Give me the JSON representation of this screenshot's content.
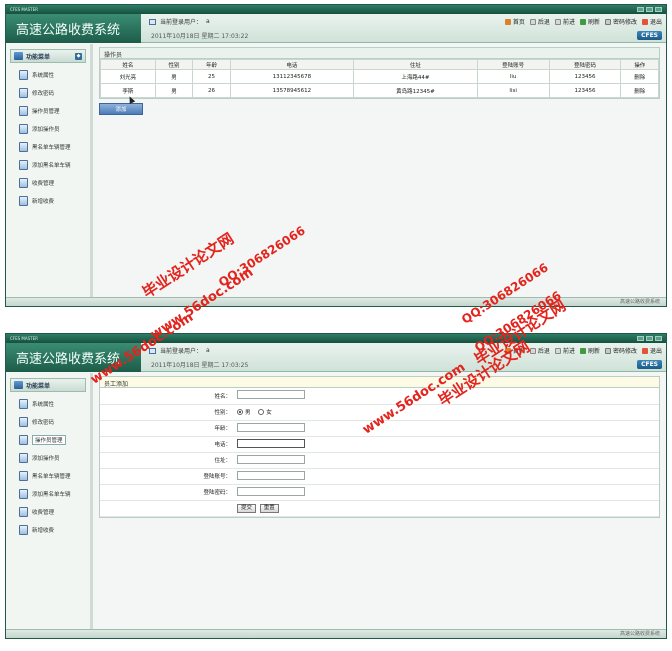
{
  "window": {
    "titlebar_text": "CFES MASTER",
    "logo_text": "高速公路收费系统",
    "current_user_label": "当前登录用户：",
    "current_user": "a",
    "badge": "CFES",
    "statusbar": "高速公路收费系统"
  },
  "toolbar": {
    "home": "首页",
    "back": "后退",
    "forward": "前进",
    "refresh": "刷新",
    "password": "密码修改",
    "logout": "退出"
  },
  "sidebar": {
    "title": "功能菜单",
    "items": [
      {
        "label": "系统属性"
      },
      {
        "label": "修改密码"
      },
      {
        "label": "操作员管理"
      },
      {
        "label": "添加操作员"
      },
      {
        "label": "黑名单车辆管理"
      },
      {
        "label": "添加黑名单车辆"
      },
      {
        "label": "收费管理"
      },
      {
        "label": "新增收费"
      }
    ]
  },
  "screen1": {
    "date": "2011年10月18日  星期二  17:03:22",
    "panel_title": "操作员",
    "columns": [
      "姓名",
      "性别",
      "年龄",
      "电话",
      "住址",
      "登陆账号",
      "登陆密码",
      "操作"
    ],
    "rows": [
      [
        "刘光亮",
        "男",
        "25",
        "13112345678",
        "上海路44#",
        "liu",
        "123456",
        "删除"
      ],
      [
        "李斯",
        "男",
        "26",
        "13578945612",
        "黄岛路12345#",
        "lisi",
        "123456",
        "删除"
      ]
    ],
    "add_button": "添加"
  },
  "screen2": {
    "date": "2011年10月18日  星期二  17:03:25",
    "panel_title": "员工添加",
    "labels": {
      "name": "姓名：",
      "gender": "性别：",
      "age": "年龄：",
      "phone": "电话：",
      "address": "住址：",
      "account": "登陆账号：",
      "password": "登陆密码："
    },
    "gender_male": "男",
    "gender_female": "女",
    "submit": "提交",
    "reset": "重置"
  },
  "watermarks": {
    "site": "www.56doc.com",
    "brand": "毕业设计论文网",
    "qq": "QQ:306826066"
  },
  "colors": {
    "titlebar": "#1c5c49",
    "logo": "#2a7560",
    "watermark": "#e3231c"
  }
}
